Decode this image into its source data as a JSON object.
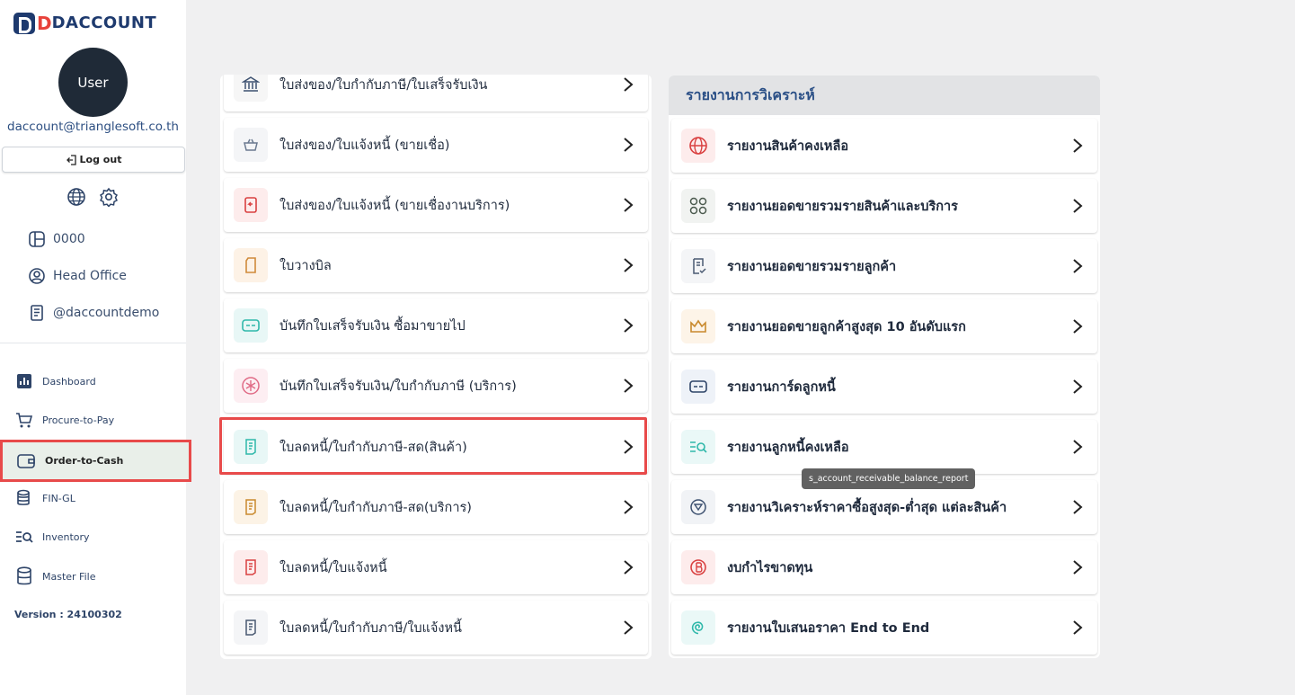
{
  "brand": {
    "d": "D",
    "name": "DACCOUNT"
  },
  "user": {
    "avatar_label": "User",
    "email": "daccount@trianglesoft.co.th",
    "logout_label": "Log out"
  },
  "meta": {
    "code": "0000",
    "branch": "Head Office",
    "handle": "@daccountdemo"
  },
  "nav": [
    {
      "label": "Dashboard",
      "icon": "bar-chart-icon"
    },
    {
      "label": "Procure-to-Pay",
      "icon": "cart-icon"
    },
    {
      "label": "Order-to-Cash",
      "icon": "wallet-icon",
      "active": true
    },
    {
      "label": "FIN-GL",
      "icon": "coins-icon"
    },
    {
      "label": "Inventory",
      "icon": "list-search-icon"
    },
    {
      "label": "Master File",
      "icon": "database-icon"
    }
  ],
  "version": "Version : 24100302",
  "documents": [
    {
      "label": "ใบส่งของ/ใบกำกับภาษี/ใบเสร็จรับเงิน",
      "icon": "bank-icon"
    },
    {
      "label": "ใบส่งของ/ใบแจ้งหนี้ (ขายเชื่อ)",
      "icon": "basket-icon"
    },
    {
      "label": "ใบส่งของ/ใบแจ้งหนี้ (ขายเชื่องานบริการ)",
      "icon": "return-doc-icon"
    },
    {
      "label": "ใบวางบิล",
      "icon": "card-outline-icon"
    },
    {
      "label": "บันทึกใบเสร็จรับเงิน ซื้อมาขายไป",
      "icon": "card-icon"
    },
    {
      "label": "บันทึกใบเสร็จรับเงิน/ใบกำกับภาษี (บริการ)",
      "icon": "star-circle-icon"
    },
    {
      "label": "ใบลดหนี้/ใบกำกับภาษี-สด(สินค้า)",
      "icon": "doc-lines-icon"
    },
    {
      "label": "ใบลดหนี้/ใบกำกับภาษี-สด(บริการ)",
      "icon": "doc-lines-icon"
    },
    {
      "label": "ใบลดหนี้/ใบแจ้งหนี้",
      "icon": "doc-lines-icon"
    },
    {
      "label": "ใบลดหนี้/ใบกำกับภาษี/ใบแจ้งหนี้",
      "icon": "doc-lines-icon"
    }
  ],
  "reports": {
    "title": "รายงานการวิเคราะห์",
    "items": [
      {
        "label": "รายงานสินค้าคงเหลือ",
        "icon": "globe-icon"
      },
      {
        "label": "รายงานยอดขายรวมรายสินค้าและบริการ",
        "icon": "grid-circles-icon"
      },
      {
        "label": "รายงานยอดขายรวมรายลูกค้า",
        "icon": "doc-check-icon"
      },
      {
        "label": "รายงานยอดขายลูกค้าสูงสุด 10 อันดับแรก",
        "icon": "crown-icon"
      },
      {
        "label": "รายงานการ์ดลูกหนี้",
        "icon": "card-icon"
      },
      {
        "label": "รายงานลูกหนี้คงเหลือ",
        "icon": "list-search-icon"
      },
      {
        "label": "รายงานวิเคราะห์ราคาซื้อสูงสุด-ต่ำสุด แต่ละสินค้า",
        "icon": "target-icon"
      },
      {
        "label": "งบกำไรขาดทุน",
        "icon": "bitcoin-icon"
      },
      {
        "label": "รายงานใบเสนอราคา End to End",
        "icon": "spiral-icon"
      }
    ]
  },
  "tooltip": "s_account_receivable_balance_report"
}
